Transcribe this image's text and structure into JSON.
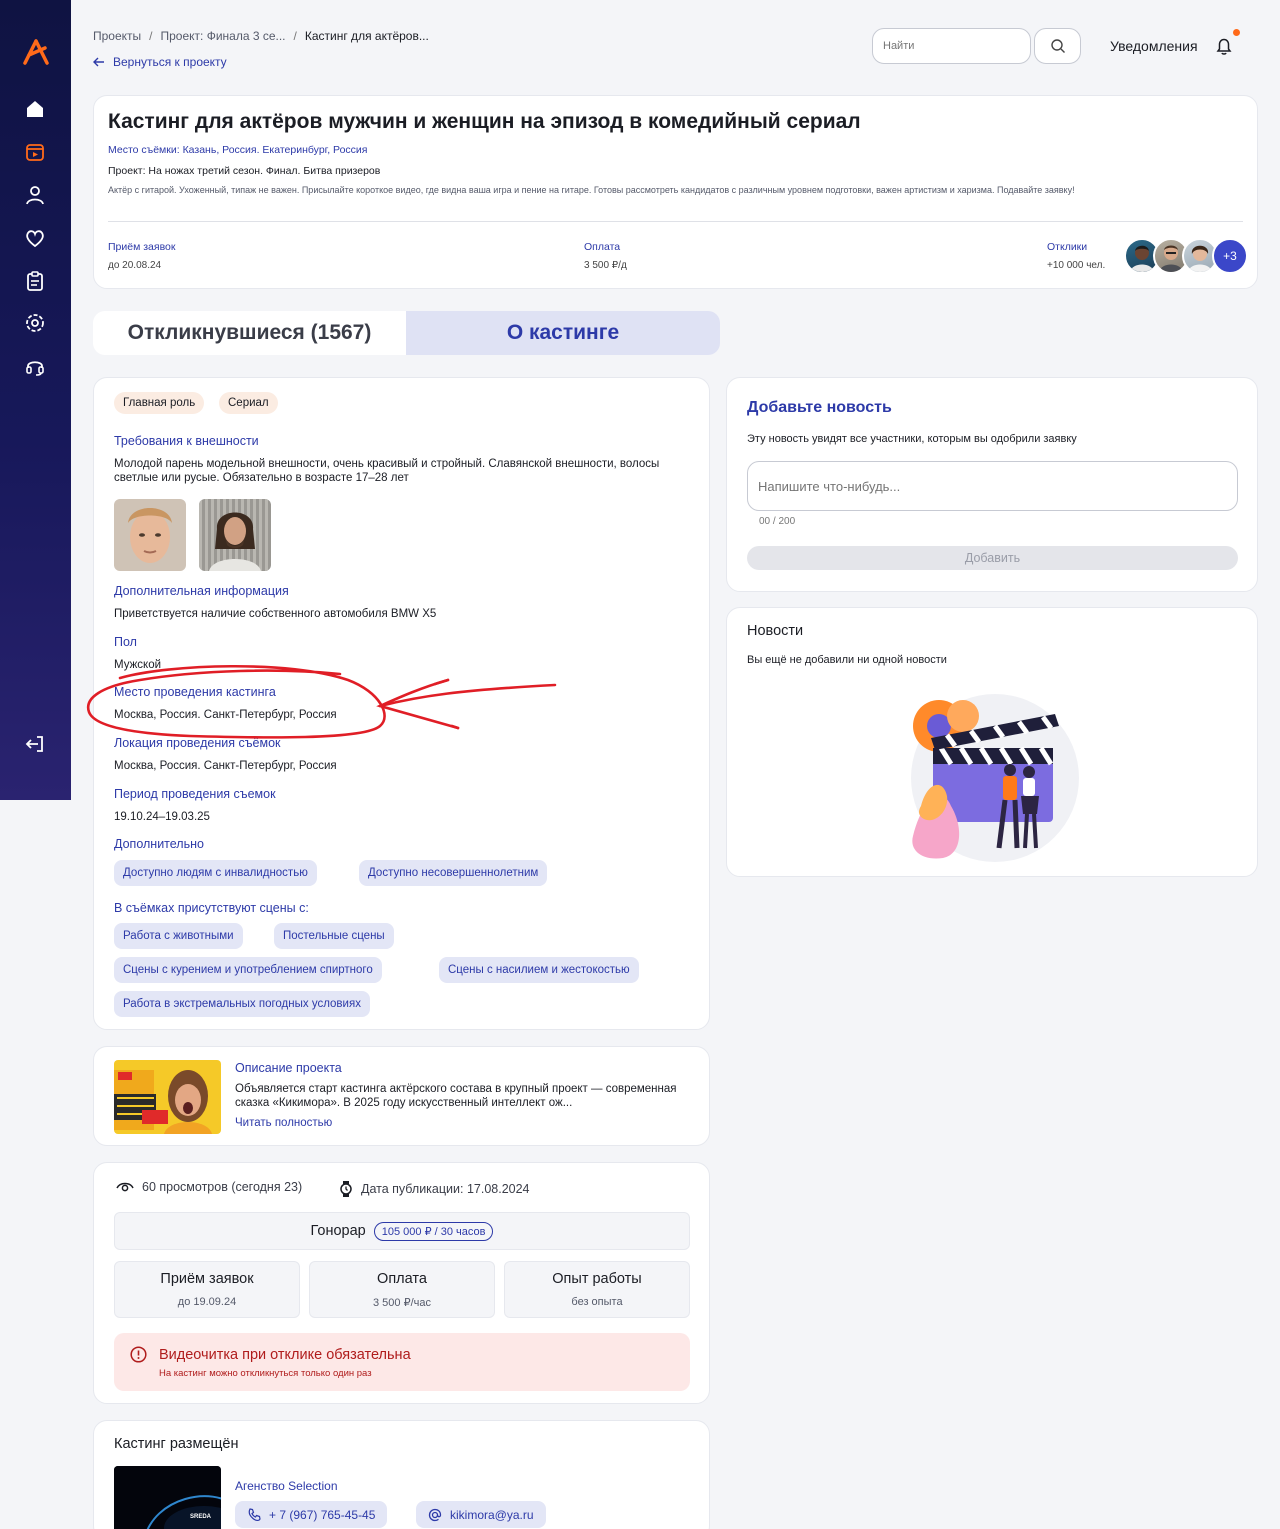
{
  "colors": {
    "accent": "#2d3aa8",
    "brand_orange": "#ff6a1a",
    "sidebar": "#17185a",
    "danger": "#b01c1c",
    "annotation": "#e01e26"
  },
  "sidebar": {
    "logo": "brand-a-logo",
    "items": [
      {
        "icon": "home-icon",
        "active": true
      },
      {
        "icon": "video-calendar-icon",
        "active": false
      },
      {
        "icon": "profile-icon",
        "active": false
      },
      {
        "icon": "heart-icon",
        "active": false
      },
      {
        "icon": "clipboard-icon",
        "active": false
      },
      {
        "icon": "settings-icon",
        "active": false
      },
      {
        "icon": "support-headset-icon",
        "active": false
      }
    ],
    "logout_icon": "logout-icon"
  },
  "breadcrumb": {
    "items": [
      "Проекты",
      "Проект: Финала 3 се...",
      "Кастинг для актёров..."
    ],
    "sep": "/",
    "back": "Вернуться к проекту"
  },
  "search": {
    "placeholder": "Найти"
  },
  "notifications": {
    "label": "Уведомления"
  },
  "header": {
    "title": "Кастинг для актёров мужчин и женщин на эпизод в комедийный сериал",
    "location": "Место съёмки: Казань, Россия. Екатеринбург, Россия",
    "project": "Проект: На ножах третий сезон. Финал. Битва призеров",
    "description": "Актёр с гитарой. Ухоженный, типаж не важен. Присылайте короткое видео, где видна ваша игра и пение на гитаре. Готовы рассмотреть кандидатов с различным уровнем подготовки, важен артистизм и харизма. Подавайте заявку!",
    "deadline_label": "Приём заявок",
    "deadline_value": "до 20.08.24",
    "payment_label": "Оплата",
    "payment_value": "3 500 ₽/д",
    "responses_label": "Отклики",
    "responses_value": "+10 000 чел.",
    "avatars_more": "+3"
  },
  "tabs": [
    {
      "label": "Откликнувшиеся (1567)",
      "active": false
    },
    {
      "label": "О кастинге",
      "active": true
    }
  ],
  "info": {
    "chips": [
      "Главная роль",
      "Сериал"
    ],
    "appearance_label": "Требования к внешности",
    "appearance_text": "Молодой парень модельной внешности, очень красивый и стройный. Славянской внешности, волосы светлые или русые. Обязательно в возрасте 17–28 лет",
    "extra_info_label": "Дополнительная информация",
    "extra_info_text": "Приветствуется наличие собственного автомобиля BMW X5",
    "gender_label": "Пол",
    "gender_text": "Мужской",
    "casting_place_label": "Место проведения кастинга",
    "casting_place_text": "Москва, Россия. Санкт-Петербург, Россия",
    "shoot_location_label": "Локация проведения съёмок",
    "shoot_location_text": "Москва, Россия. Санкт-Петербург, Россия",
    "period_label": "Период проведения съемок",
    "period_text": "19.10.24–19.03.25",
    "additional_label": "Дополнительно",
    "additional_tags": [
      "Доступно людям с инвалидностью",
      "Доступно несовершеннолетним"
    ],
    "scenes_label": "В съёмках присутствуют сцены с:",
    "scene_tags": [
      "Работа с животными",
      "Постельные сцены",
      "Сцены с курением и употреблением спиртного",
      "Сцены с насилием и жестокостью",
      "Работа в экстремальных погодных условиях"
    ]
  },
  "add_news": {
    "title": "Добавьте новость",
    "subtitle": "Эту новость увидят все участники, которым вы одобрили заявку",
    "placeholder": "Напишите что-нибудь...",
    "counter": "00 / 200",
    "button": "Добавить"
  },
  "news": {
    "title": "Новости",
    "empty": "Вы ещё не добавили ни одной новости"
  },
  "project_desc": {
    "title": "Описание проекта",
    "text": "Объявляется старт кастинга актёрского состава в крупный проект — современная сказка «Кикимора». В 2025 году искусственный интеллект ож...",
    "more": "Читать полностью"
  },
  "stats": {
    "views": "60 просмотров (сегодня 23)",
    "published": "Дата публикации: 17.08.2024",
    "fee_label": "Гонорар",
    "fee_value": "105 000 ₽ / 30 часов",
    "boxes": [
      {
        "label": "Приём заявок",
        "value": "до 19.09.24"
      },
      {
        "label": "Оплата",
        "value": "3 500 ₽/час"
      },
      {
        "label": "Опыт работы",
        "value": "без опыта"
      }
    ],
    "alert_title": "Видеочитка при отклике обязательна",
    "alert_sub": "На кастинг можно откликнуться только один раз"
  },
  "placed": {
    "title": "Кастинг размещён",
    "agency": "Агенство Selection",
    "phone": "+ 7 (967) 765-45-45",
    "email": "kikimora@ya.ru"
  }
}
